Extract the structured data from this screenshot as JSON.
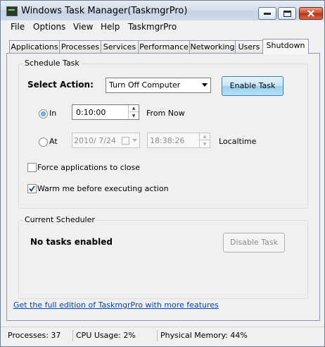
{
  "window": {
    "title": "Windows Task Manager(TaskmgrPro)"
  },
  "menu": [
    "File",
    "Options",
    "View",
    "Help",
    "TaskmgrPro"
  ],
  "tabs": [
    "Applications",
    "Processes",
    "Services",
    "Performance",
    "Networking",
    "Users",
    "Shutdown"
  ],
  "active_tab": "Shutdown",
  "schedule": {
    "group_label": "Schedule Task",
    "select_action_label": "Select Action:",
    "action_value": "Turn Off Computer",
    "enable_button": "Enable Task",
    "in_label": "In",
    "in_value": "0:10:00",
    "from_now": "From Now",
    "at_label": "At",
    "at_date": "2010/  7/24",
    "at_time": "18:38:26",
    "localtime": "Localtime",
    "force_label": "Force applications to close",
    "force_checked": false,
    "warn_label": "Warm me before executing action",
    "warn_checked": true
  },
  "scheduler": {
    "group_label": "Current Scheduler",
    "status": "No tasks enabled",
    "disable_button": "Disable Task"
  },
  "link": "Get the full edition of TaskmgrPro with more features",
  "status": {
    "processes": "Processes: 37",
    "cpu": "CPU Usage: 2%",
    "memory": "Physical Memory: 44%"
  },
  "colors": {
    "link": "#0645ad",
    "focus_button": "#3c7fb1",
    "close_button": "#c8452a"
  }
}
